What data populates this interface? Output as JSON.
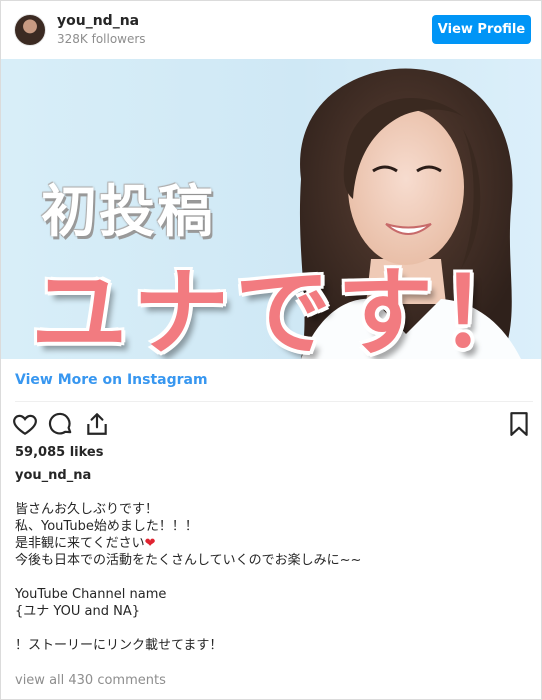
{
  "header": {
    "username": "you_nd_na",
    "followers": "328K followers",
    "view_profile_label": "View Profile"
  },
  "image": {
    "text_top": "初投稿",
    "text_main": "ユナです！"
  },
  "view_more_label": "View More on Instagram",
  "actions": {
    "icons": [
      "heart-icon",
      "comment-icon",
      "share-icon",
      "bookmark-icon"
    ]
  },
  "likes": "59,085 likes",
  "caption": {
    "username": "you_nd_na",
    "line1": "皆さんお久しぶりです！",
    "line2": "私、YouTube始めました！！！",
    "line3": "是非観に来てください",
    "line3_emoji": "❤",
    "line4": "今後も日本での活動をたくさんしていくのでお楽しみに~~",
    "line5": "",
    "line6": "YouTube Channel name",
    "line7": "{ユナ YOU and NA}",
    "line8": "",
    "line9": "！ストーリーにリンク載せてます！"
  },
  "view_comments": "view all 430 comments",
  "colors": {
    "accent_button": "#0095f6",
    "link": "#3897f0",
    "pink_text": "#f27b80",
    "muted": "#8e8e8e"
  }
}
